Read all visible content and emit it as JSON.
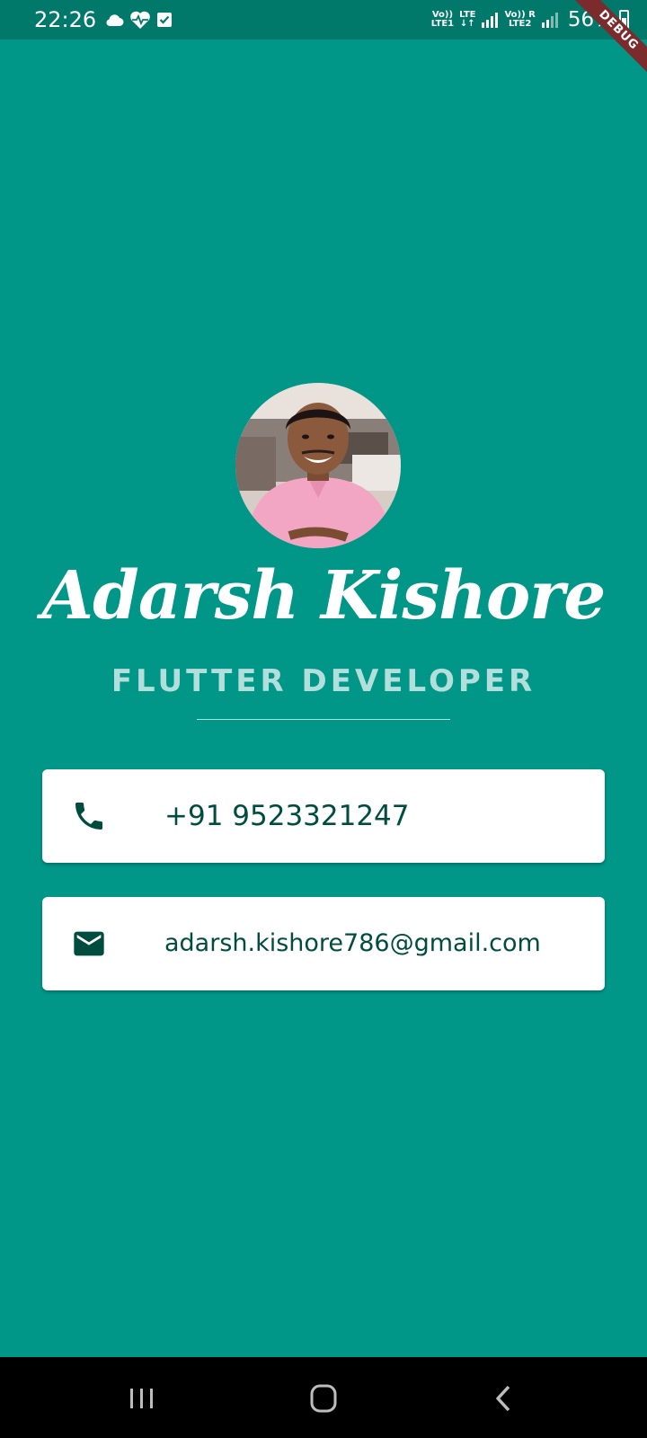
{
  "status_bar": {
    "time": "22:26",
    "left_icons": [
      "cloud-icon",
      "heart-monitor-icon",
      "checkbox-icon"
    ],
    "sim1_top": "Vo))",
    "sim1_bottom": "LTE1",
    "lte_top": "LTE",
    "lte_bottom": "↓↑",
    "sim2_top": "Vo)) R",
    "sim2_bottom": "LTE2",
    "battery": "56%"
  },
  "debug_banner": "DEBUG",
  "profile": {
    "name": "Adarsh Kishore",
    "role": "FLUTTER DEVELOPER"
  },
  "contacts": {
    "phone": "+91 9523321247",
    "email": "adarsh.kishore786@gmail.com"
  },
  "colors": {
    "background": "#009688",
    "status_bar": "#00796b",
    "accent_text": "#004d40",
    "role_text": "#b2dfdb"
  },
  "nav_bar": {
    "icons": [
      "recent-apps-icon",
      "home-icon",
      "back-icon"
    ]
  }
}
